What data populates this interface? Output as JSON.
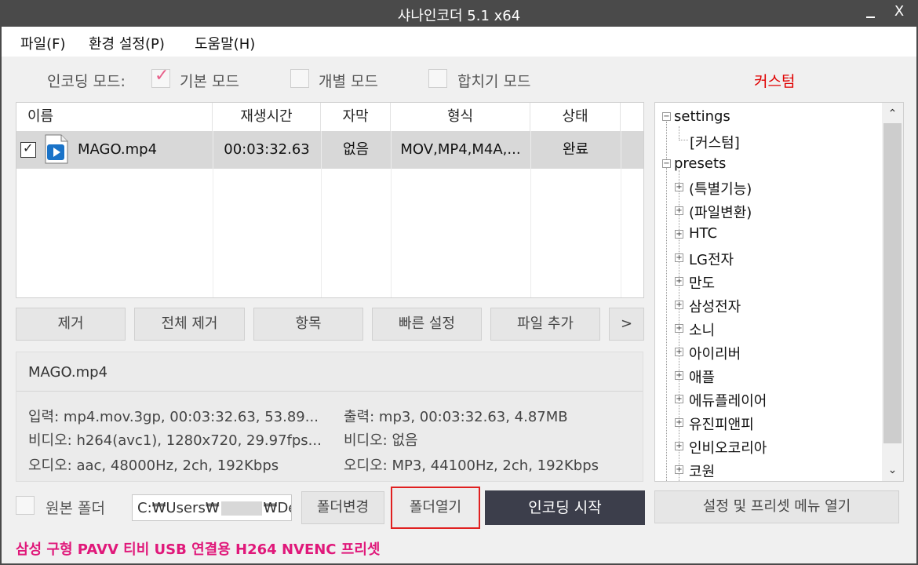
{
  "window": {
    "title": "샤나인코더 5.1 x64",
    "close_label": "X"
  },
  "menu": {
    "file": "파일(F)",
    "settings": "환경 설정(P)",
    "help": "도움말(H)"
  },
  "mode": {
    "label": "인코딩 모드:",
    "basic": "기본 모드",
    "basic_checked": true,
    "individual": "개별 모드",
    "merge": "합치기 모드",
    "custom": "커스텀"
  },
  "file_table": {
    "columns": [
      "이름",
      "재생시간",
      "자막",
      "형식",
      "상태"
    ],
    "rows": [
      {
        "checked": true,
        "name": "MAGO.mp4",
        "duration": "00:03:32.63",
        "subtitle": "없음",
        "format": "MOV,MP4,M4A,...",
        "status": "완료"
      }
    ]
  },
  "buttons": {
    "remove": "제거",
    "remove_all": "전체 제거",
    "items": "항목",
    "quick_settings": "빠른 설정",
    "add_file": "파일 추가",
    "more": ">"
  },
  "info": {
    "filename": "MAGO.mp4",
    "input": "입력: mp4.mov.3gp, 00:03:32.63, 53.89...",
    "input_video": "비디오: h264(avc1), 1280x720, 29.97fps...",
    "input_audio": "오디오: aac, 48000Hz, 2ch, 192Kbps",
    "output": "출력: mp3, 00:03:32.63, 4.87MB",
    "output_video": "비디오: 없음",
    "output_audio": "오디오: MP3, 44100Hz, 2ch, 192Kbps"
  },
  "tree": {
    "settings": "settings",
    "settings_child": "[커스텀]",
    "presets": "presets",
    "preset_items": [
      "(특별기능)",
      "(파일변환)",
      "HTC",
      "LG전자",
      "만도",
      "삼성전자",
      "소니",
      "아이리버",
      "애플",
      "에듀플레이어",
      "유진피앤피",
      "인비오코리아",
      "코원"
    ]
  },
  "bottom": {
    "source_folder": "원본 폴더",
    "path_prefix": "C:₩Users₩",
    "path_suffix": "₩Des",
    "change_folder": "폴더변경",
    "open_folder": "폴더열기",
    "start_encoding": "인코딩 시작",
    "open_menu": "설정 및 프리셋 메뉴 열기"
  },
  "status": "삼성 구형 PAVV 티비 USB 연결용 H264 NVENC 프리셋",
  "colors": {
    "titlebar": "#4a4a4a",
    "accent_red": "#e00000",
    "status_pink": "#e0187a",
    "encode_button": "#3c3e4b",
    "check_pink": "#e8608a"
  }
}
